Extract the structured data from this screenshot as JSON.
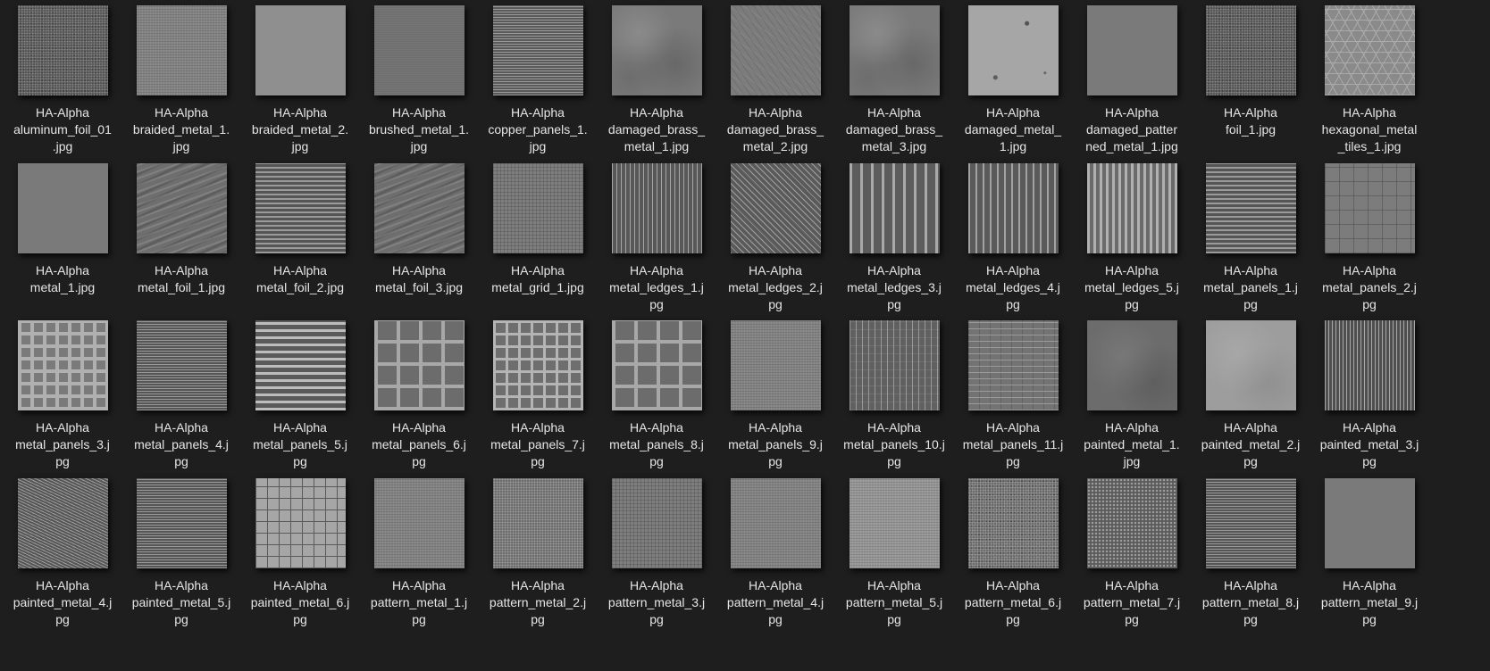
{
  "folder": {
    "columns": 12,
    "items": [
      {
        "name": [
          "HA-Alpha",
          "aluminum_foil_01",
          ".jpg"
        ],
        "pattern": "noise-dark"
      },
      {
        "name": [
          "HA-Alpha",
          "braided_metal_1.",
          "jpg"
        ],
        "pattern": "fine-weave"
      },
      {
        "name": [
          "HA-Alpha",
          "braided_metal_2.",
          "jpg"
        ],
        "pattern": "flat-light"
      },
      {
        "name": [
          "HA-Alpha",
          "brushed_metal_1.",
          "jpg"
        ],
        "pattern": "brushed"
      },
      {
        "name": [
          "HA-Alpha",
          "copper_panels_1.",
          "jpg"
        ],
        "pattern": "fine-h-lines"
      },
      {
        "name": [
          "HA-Alpha",
          "damaged_brass_",
          "metal_1.jpg"
        ],
        "pattern": "cloudy"
      },
      {
        "name": [
          "HA-Alpha",
          "damaged_brass_",
          "metal_2.jpg"
        ],
        "pattern": "scratched"
      },
      {
        "name": [
          "HA-Alpha",
          "damaged_brass_",
          "metal_3.jpg"
        ],
        "pattern": "cloudy"
      },
      {
        "name": [
          "HA-Alpha",
          "damaged_metal_",
          "1.jpg"
        ],
        "pattern": "pitted"
      },
      {
        "name": [
          "HA-Alpha",
          "damaged_patter",
          "ned_metal_1.jpg"
        ],
        "pattern": "flat-mid"
      },
      {
        "name": [
          "HA-Alpha",
          "foil_1.jpg"
        ],
        "pattern": "noise-dark"
      },
      {
        "name": [
          "HA-Alpha",
          "hexagonal_metal",
          "_tiles_1.jpg"
        ],
        "pattern": "hex"
      },
      {
        "name": [
          "HA-Alpha",
          "metal_1.jpg"
        ],
        "pattern": "flat-mid"
      },
      {
        "name": [
          "HA-Alpha",
          "metal_foil_1.jpg"
        ],
        "pattern": "streaky"
      },
      {
        "name": [
          "HA-Alpha",
          "metal_foil_2.jpg"
        ],
        "pattern": "h-lines-med"
      },
      {
        "name": [
          "HA-Alpha",
          "metal_foil_3.jpg"
        ],
        "pattern": "streaky"
      },
      {
        "name": [
          "HA-Alpha",
          "metal_grid_1.jpg"
        ],
        "pattern": "fine-grid"
      },
      {
        "name": [
          "HA-Alpha",
          "metal_ledges_1.j",
          "pg"
        ],
        "pattern": "v-lines-fine"
      },
      {
        "name": [
          "HA-Alpha",
          "metal_ledges_2.j",
          "pg"
        ],
        "pattern": "diag-lines"
      },
      {
        "name": [
          "HA-Alpha",
          "metal_ledges_3.j",
          "pg"
        ],
        "pattern": "v-bars-wide"
      },
      {
        "name": [
          "HA-Alpha",
          "metal_ledges_4.j",
          "pg"
        ],
        "pattern": "v-bars-med"
      },
      {
        "name": [
          "HA-Alpha",
          "metal_ledges_5.j",
          "pg"
        ],
        "pattern": "v-bars-light"
      },
      {
        "name": [
          "HA-Alpha",
          "metal_panels_1.j",
          "pg"
        ],
        "pattern": "h-lines-med"
      },
      {
        "name": [
          "HA-Alpha",
          "metal_panels_2.j",
          "pg"
        ],
        "pattern": "tiles-rough"
      },
      {
        "name": [
          "HA-Alpha",
          "metal_panels_3.j",
          "pg"
        ],
        "pattern": "checker-grid"
      },
      {
        "name": [
          "HA-Alpha",
          "metal_panels_4.j",
          "pg"
        ],
        "pattern": "h-lines-fine"
      },
      {
        "name": [
          "HA-Alpha",
          "metal_panels_5.j",
          "pg"
        ],
        "pattern": "h-bars"
      },
      {
        "name": [
          "HA-Alpha",
          "metal_panels_6.j",
          "pg"
        ],
        "pattern": "big-grid"
      },
      {
        "name": [
          "HA-Alpha",
          "metal_panels_7.j",
          "pg"
        ],
        "pattern": "small-grid"
      },
      {
        "name": [
          "HA-Alpha",
          "metal_panels_8.j",
          "pg"
        ],
        "pattern": "big-grid"
      },
      {
        "name": [
          "HA-Alpha",
          "metal_panels_9.j",
          "pg"
        ],
        "pattern": "fine-weave"
      },
      {
        "name": [
          "HA-Alpha",
          "metal_panels_10.j",
          "pg"
        ],
        "pattern": "brick-v"
      },
      {
        "name": [
          "HA-Alpha",
          "metal_panels_11.j",
          "pg"
        ],
        "pattern": "brick-h"
      },
      {
        "name": [
          "HA-Alpha",
          "painted_metal_1.",
          "jpg"
        ],
        "pattern": "cloudy-dark"
      },
      {
        "name": [
          "HA-Alpha",
          "painted_metal_2.j",
          "pg"
        ],
        "pattern": "cloudy-light"
      },
      {
        "name": [
          "HA-Alpha",
          "painted_metal_3.j",
          "pg"
        ],
        "pattern": "v-lines-dense"
      },
      {
        "name": [
          "HA-Alpha",
          "painted_metal_4.j",
          "pg"
        ],
        "pattern": "diag-fine"
      },
      {
        "name": [
          "HA-Alpha",
          "painted_metal_5.j",
          "pg"
        ],
        "pattern": "h-lines-fine"
      },
      {
        "name": [
          "HA-Alpha",
          "painted_metal_6.j",
          "pg"
        ],
        "pattern": "tile-grid-light"
      },
      {
        "name": [
          "HA-Alpha",
          "pattern_metal_1.j",
          "pg"
        ],
        "pattern": "fine-weave"
      },
      {
        "name": [
          "HA-Alpha",
          "pattern_metal_2.j",
          "pg"
        ],
        "pattern": "dots"
      },
      {
        "name": [
          "HA-Alpha",
          "pattern_metal_3.j",
          "pg"
        ],
        "pattern": "fine-grid"
      },
      {
        "name": [
          "HA-Alpha",
          "pattern_metal_4.j",
          "pg"
        ],
        "pattern": "fine-weave"
      },
      {
        "name": [
          "HA-Alpha",
          "pattern_metal_5.j",
          "pg"
        ],
        "pattern": "fine-weave-light"
      },
      {
        "name": [
          "HA-Alpha",
          "pattern_metal_6.j",
          "pg"
        ],
        "pattern": "noise-mid"
      },
      {
        "name": [
          "HA-Alpha",
          "pattern_metal_7.j",
          "pg"
        ],
        "pattern": "dots-dense"
      },
      {
        "name": [
          "HA-Alpha",
          "pattern_metal_8.j",
          "pg"
        ],
        "pattern": "h-lines-fine"
      },
      {
        "name": [
          "HA-Alpha",
          "pattern_metal_9.j",
          "pg"
        ],
        "pattern": "flat-mid"
      }
    ]
  }
}
